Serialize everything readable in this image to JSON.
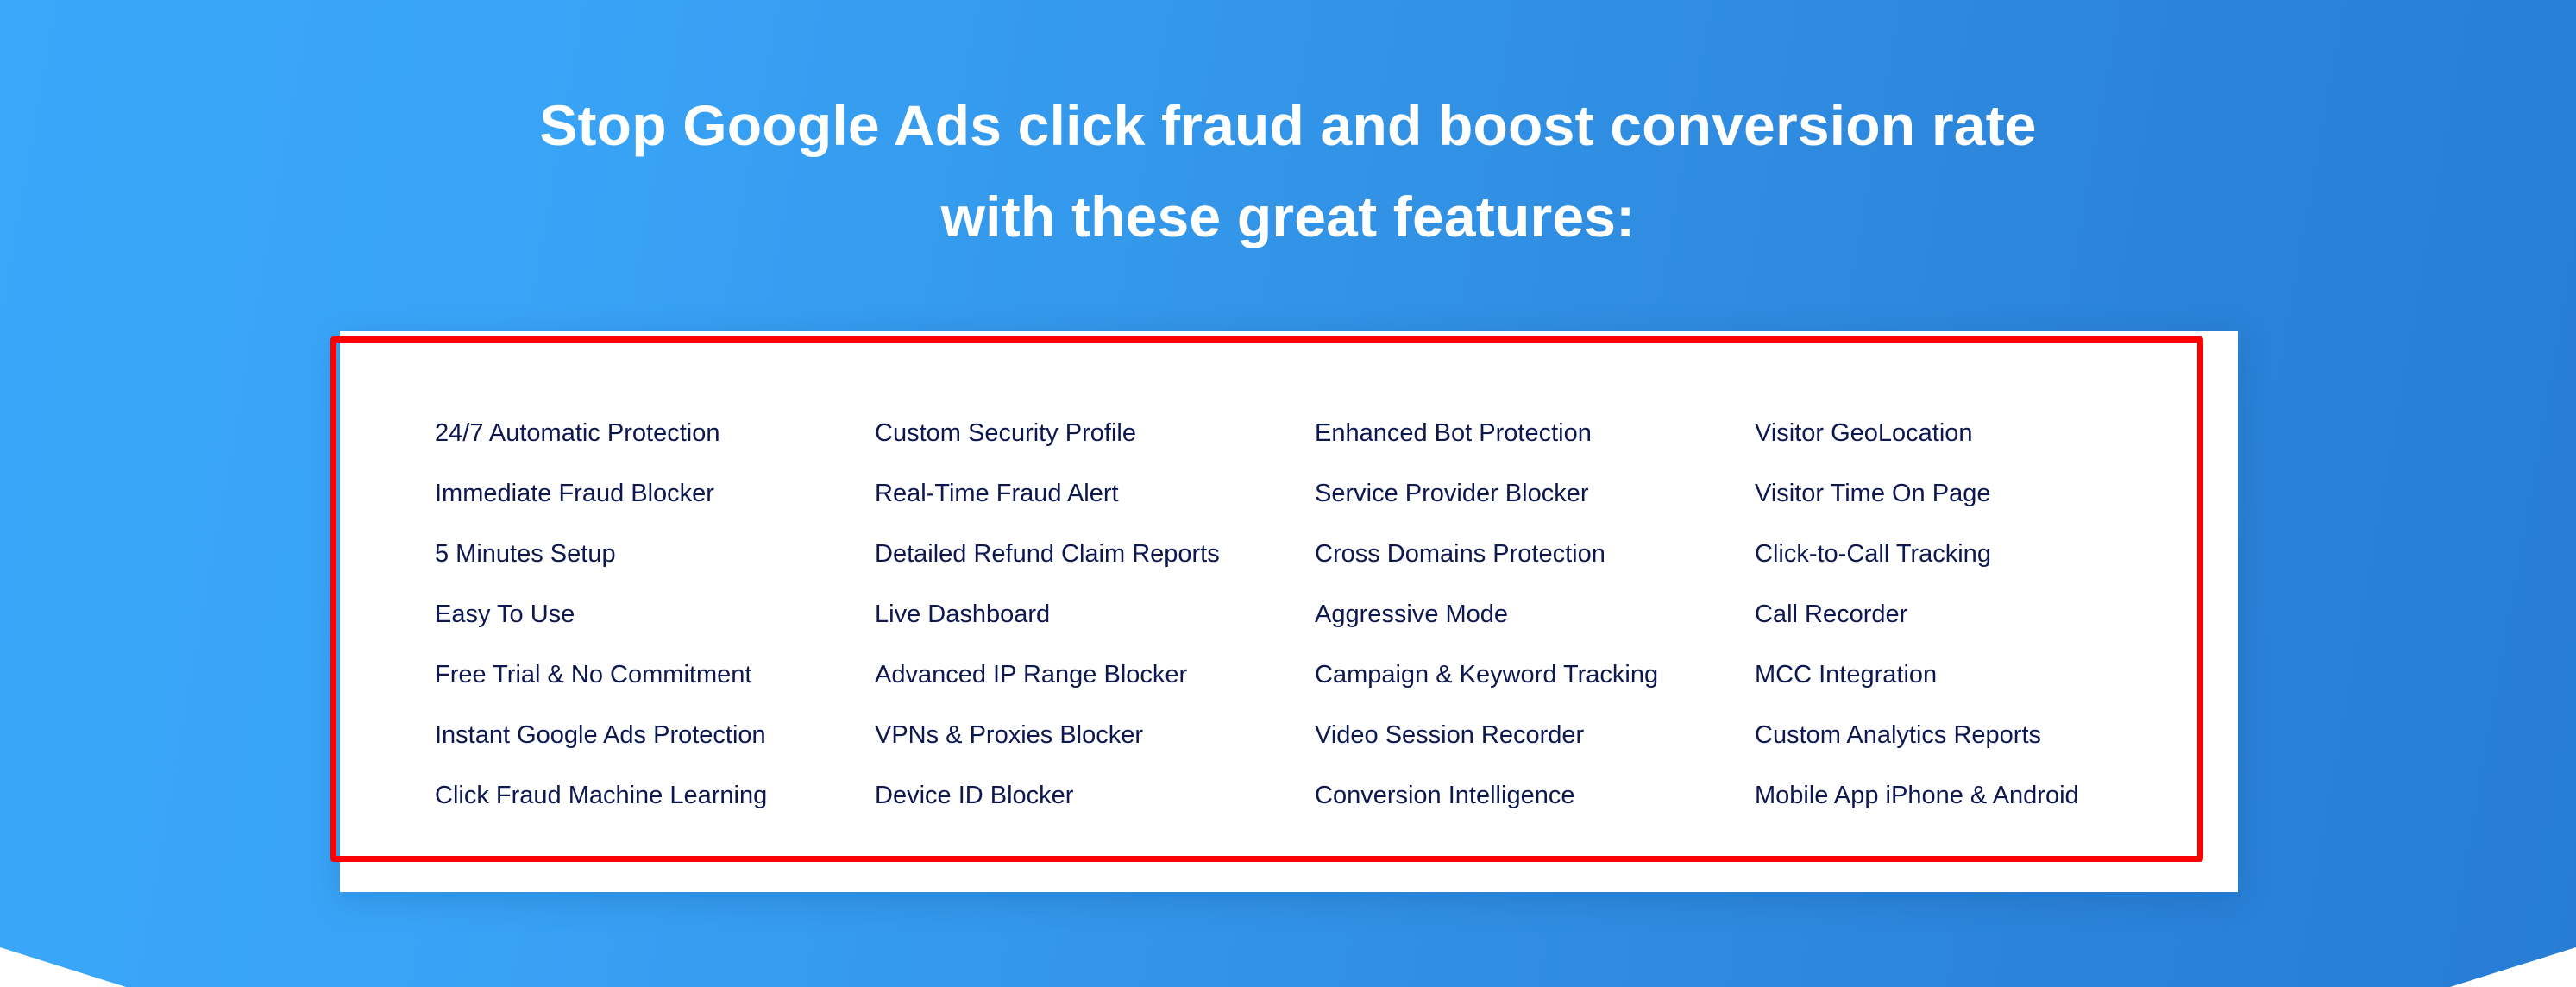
{
  "colors": {
    "background_left": "#3aa7f9",
    "background_right": "#277dd5",
    "title_text": "#ffffff",
    "feature_text": "#0d1850",
    "card_background": "#ffffff",
    "highlight_border": "#ff0000"
  },
  "header": {
    "title_line1": "Stop Google Ads click fraud and boost conversion rate",
    "title_line2": "with these great features:"
  },
  "features": {
    "columns": [
      {
        "items": [
          "24/7 Automatic Protection",
          "Immediate Fraud Blocker",
          "5 Minutes Setup",
          "Easy To Use",
          "Free Trial & No Commitment",
          "Instant Google Ads Protection",
          "Click Fraud Machine Learning"
        ]
      },
      {
        "items": [
          "Custom Security Profile",
          "Real-Time Fraud Alert",
          "Detailed Refund Claim Reports",
          "Live Dashboard",
          "Advanced IP Range Blocker",
          "VPNs & Proxies Blocker",
          "Device ID Blocker"
        ]
      },
      {
        "items": [
          "Enhanced Bot Protection",
          "Service Provider Blocker",
          "Cross Domains Protection",
          "Aggressive Mode",
          "Campaign & Keyword Tracking",
          "Video Session Recorder",
          "Conversion Intelligence"
        ]
      },
      {
        "items": [
          "Visitor GeoLocation",
          "Visitor Time On Page",
          "Click-to-Call Tracking",
          "Call Recorder",
          "MCC Integration",
          "Custom Analytics Reports",
          "Mobile App iPhone & Android"
        ]
      }
    ]
  }
}
